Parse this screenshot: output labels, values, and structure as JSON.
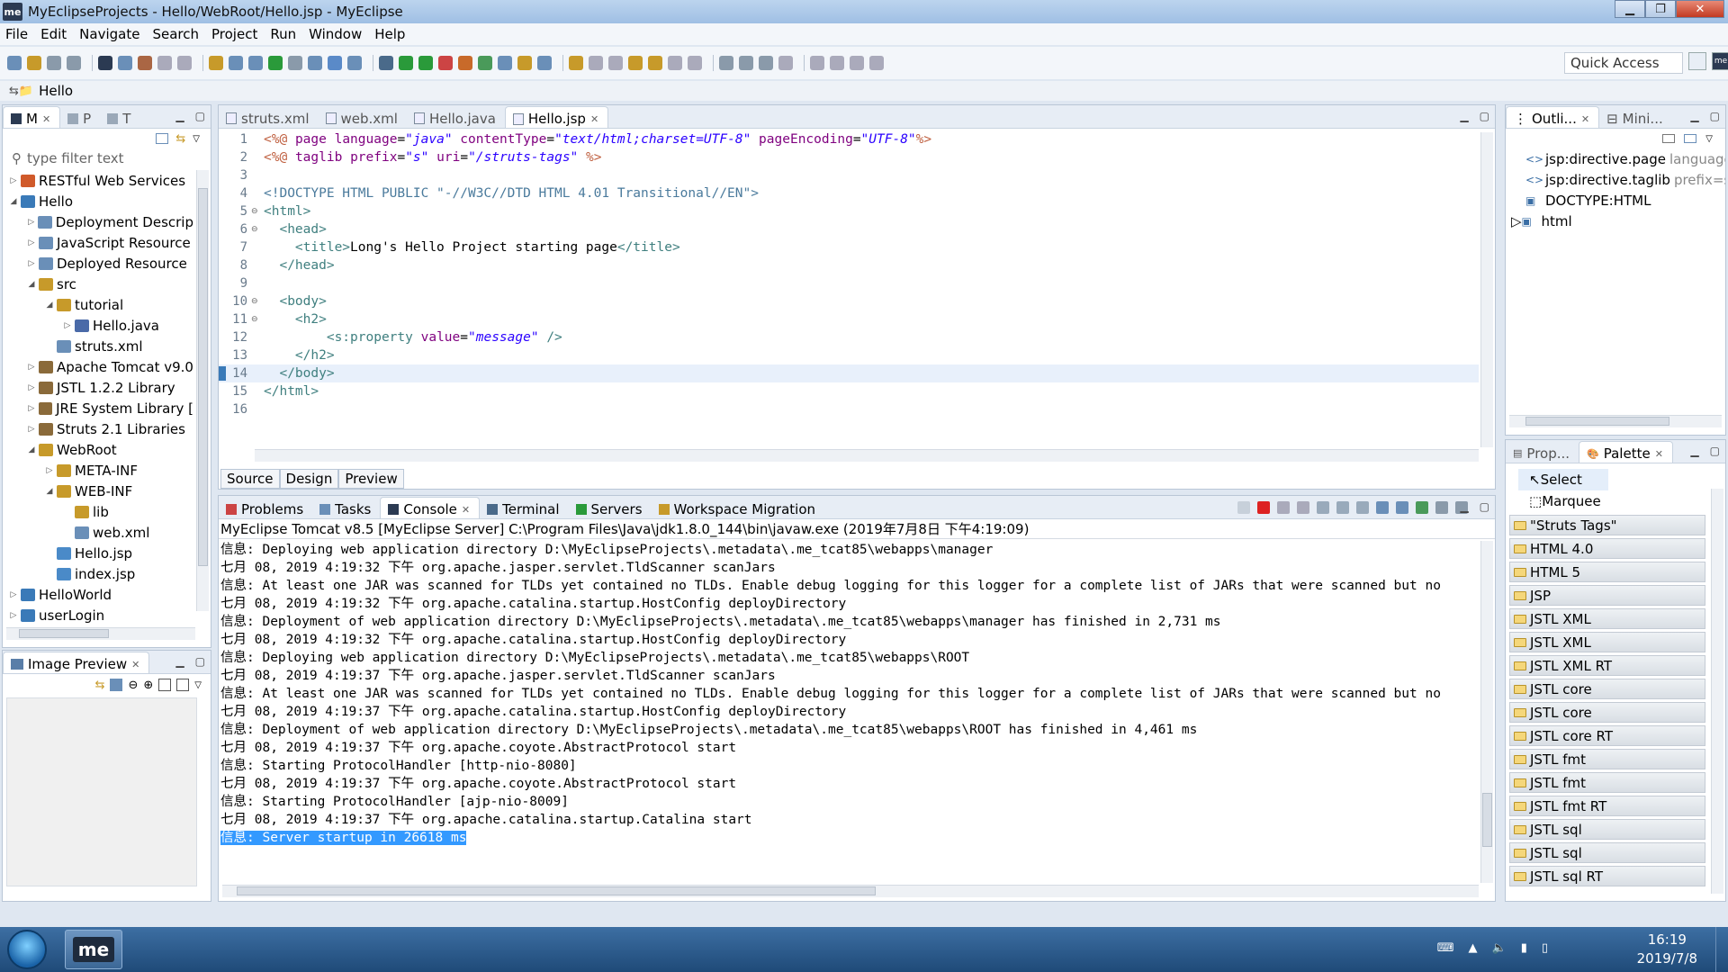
{
  "window": {
    "title": "MyEclipseProjects - Hello/WebRoot/Hello.jsp - MyEclipse",
    "logo": "me"
  },
  "menu": [
    "File",
    "Edit",
    "Navigate",
    "Search",
    "Project",
    "Run",
    "Window",
    "Help"
  ],
  "quick_access": "Quick Access",
  "breadcrumb": "Hello",
  "explorer": {
    "tabs": [
      "M",
      "P",
      "T"
    ],
    "filter_placeholder": "type filter text",
    "items": [
      {
        "label": "RESTful Web Services",
        "level": 0,
        "arrow": "▷"
      },
      {
        "label": "Hello",
        "level": 0,
        "arrow": "◢"
      },
      {
        "label": "Deployment Descrip",
        "level": 1,
        "arrow": "▷"
      },
      {
        "label": "JavaScript Resource",
        "level": 1,
        "arrow": "▷"
      },
      {
        "label": "Deployed Resource",
        "level": 1,
        "arrow": "▷"
      },
      {
        "label": "src",
        "level": 1,
        "arrow": "◢"
      },
      {
        "label": "tutorial",
        "level": 2,
        "arrow": "◢"
      },
      {
        "label": "Hello.java",
        "level": 3,
        "arrow": "▷"
      },
      {
        "label": "struts.xml",
        "level": 2,
        "arrow": ""
      },
      {
        "label": "Apache Tomcat v9.0",
        "level": 1,
        "arrow": "▷"
      },
      {
        "label": "JSTL 1.2.2 Library",
        "level": 1,
        "arrow": "▷"
      },
      {
        "label": "JRE System Library [",
        "level": 1,
        "arrow": "▷"
      },
      {
        "label": "Struts 2.1 Libraries",
        "level": 1,
        "arrow": "▷"
      },
      {
        "label": "WebRoot",
        "level": 1,
        "arrow": "◢"
      },
      {
        "label": "META-INF",
        "level": 2,
        "arrow": "▷"
      },
      {
        "label": "WEB-INF",
        "level": 2,
        "arrow": "◢"
      },
      {
        "label": "lib",
        "level": 3,
        "arrow": ""
      },
      {
        "label": "web.xml",
        "level": 3,
        "arrow": ""
      },
      {
        "label": "Hello.jsp",
        "level": 2,
        "arrow": ""
      },
      {
        "label": "index.jsp",
        "level": 2,
        "arrow": ""
      },
      {
        "label": "HelloWorld",
        "level": 0,
        "arrow": "▷"
      },
      {
        "label": "userLogin",
        "level": 0,
        "arrow": "▷"
      }
    ]
  },
  "image_preview": {
    "title": "Image Preview"
  },
  "editor": {
    "tabs": [
      {
        "label": "struts.xml",
        "active": false
      },
      {
        "label": "web.xml",
        "active": false
      },
      {
        "label": "Hello.java",
        "active": false
      },
      {
        "label": "Hello.jsp",
        "active": true
      }
    ],
    "lines": [
      {
        "n": "1",
        "fold": "",
        "html": "<span class='dir'>&lt;%@</span> <span class='attr'>page</span> <span class='attr'>language</span>=<span class='val'>\"java\"</span> <span class='attr'>contentType</span>=<span class='val'>\"text/html;charset=UTF-8\"</span> <span class='attr'>pageEncoding</span>=<span class='val'>\"UTF-8\"</span><span class='dir'>%&gt;</span>"
      },
      {
        "n": "2",
        "fold": "",
        "html": "<span class='dir'>&lt;%@</span> <span class='attr'>taglib</span> <span class='attr'>prefix</span>=<span class='val'>\"s\"</span> <span class='attr'>uri</span>=<span class='val'>\"/struts-tags\"</span> <span class='dir'>%&gt;</span>"
      },
      {
        "n": "3",
        "fold": "",
        "html": ""
      },
      {
        "n": "4",
        "fold": "",
        "html": "<span class='doct'>&lt;!DOCTYPE HTML PUBLIC \"-//W3C//DTD HTML 4.01 Transitional//EN\"&gt;</span>"
      },
      {
        "n": "5",
        "fold": "⊖",
        "html": "<span class='tag'>&lt;html&gt;</span>"
      },
      {
        "n": "6",
        "fold": "⊖",
        "html": "  <span class='tag'>&lt;head&gt;</span>"
      },
      {
        "n": "7",
        "fold": "",
        "html": "    <span class='tag'>&lt;title&gt;</span>Long's Hello Project starting page<span class='tag'>&lt;/title&gt;</span>"
      },
      {
        "n": "8",
        "fold": "",
        "html": "  <span class='tag'>&lt;/head&gt;</span>"
      },
      {
        "n": "9",
        "fold": "",
        "html": ""
      },
      {
        "n": "10",
        "fold": "⊖",
        "html": "  <span class='tag'>&lt;body&gt;</span>"
      },
      {
        "n": "11",
        "fold": "⊖",
        "html": "    <span class='tag'>&lt;h2&gt;</span>"
      },
      {
        "n": "12",
        "fold": "",
        "html": "        <span class='tag'>&lt;s:property</span> <span class='attr'>value</span>=<span class='val'>\"message\"</span> <span class='tag'>/&gt;</span>"
      },
      {
        "n": "13",
        "fold": "",
        "html": "    <span class='tag'>&lt;/h2&gt;</span>"
      },
      {
        "n": "14",
        "fold": "",
        "html": "  <span class='tag'>&lt;/body&gt;</span>",
        "current": true
      },
      {
        "n": "15",
        "fold": "",
        "html": "<span class='tag'>&lt;/html&gt;</span>"
      },
      {
        "n": "16",
        "fold": "",
        "html": ""
      }
    ],
    "mode_tabs": [
      "Source",
      "Design",
      "Preview"
    ]
  },
  "console": {
    "tabs": [
      {
        "label": "Problems",
        "active": false
      },
      {
        "label": "Tasks",
        "active": false
      },
      {
        "label": "Console",
        "active": true
      },
      {
        "label": "Terminal",
        "active": false
      },
      {
        "label": "Servers",
        "active": false
      },
      {
        "label": "Workspace Migration",
        "active": false
      }
    ],
    "process": "MyEclipse Tomcat v8.5 [MyEclipse Server] C:\\Program Files\\Java\\jdk1.8.0_144\\bin\\javaw.exe (2019年7月8日 下午4:19:09)",
    "lines": [
      "信息: Deploying web application directory D:\\MyEclipseProjects\\.metadata\\.me_tcat85\\webapps\\manager",
      "七月 08, 2019 4:19:32 下午 org.apache.jasper.servlet.TldScanner scanJars",
      "信息: At least one JAR was scanned for TLDs yet contained no TLDs. Enable debug logging for this logger for a complete list of JARs that were scanned but no",
      "七月 08, 2019 4:19:32 下午 org.apache.catalina.startup.HostConfig deployDirectory",
      "信息: Deployment of web application directory D:\\MyEclipseProjects\\.metadata\\.me_tcat85\\webapps\\manager has finished in 2,731 ms",
      "七月 08, 2019 4:19:32 下午 org.apache.catalina.startup.HostConfig deployDirectory",
      "信息: Deploying web application directory D:\\MyEclipseProjects\\.metadata\\.me_tcat85\\webapps\\ROOT",
      "七月 08, 2019 4:19:37 下午 org.apache.jasper.servlet.TldScanner scanJars",
      "信息: At least one JAR was scanned for TLDs yet contained no TLDs. Enable debug logging for this logger for a complete list of JARs that were scanned but no",
      "七月 08, 2019 4:19:37 下午 org.apache.catalina.startup.HostConfig deployDirectory",
      "信息: Deployment of web application directory D:\\MyEclipseProjects\\.metadata\\.me_tcat85\\webapps\\ROOT has finished in 4,461 ms",
      "七月 08, 2019 4:19:37 下午 org.apache.coyote.AbstractProtocol start",
      "信息: Starting ProtocolHandler [http-nio-8080]",
      "七月 08, 2019 4:19:37 下午 org.apache.coyote.AbstractProtocol start",
      "信息: Starting ProtocolHandler [ajp-nio-8009]",
      "七月 08, 2019 4:19:37 下午 org.apache.catalina.startup.Catalina start"
    ],
    "highlighted_line": "信息: Server startup in 26618 ms"
  },
  "outline": {
    "tabs": [
      "Outli...",
      "Mini..."
    ],
    "items": [
      {
        "label": "jsp:directive.page",
        "hint": "language",
        "icon": "<>"
      },
      {
        "label": "jsp:directive.taglib",
        "hint": "prefix=s",
        "icon": "<>"
      },
      {
        "label": "DOCTYPE:HTML",
        "hint": "",
        "icon": "▣"
      },
      {
        "label": "html",
        "hint": "",
        "icon": "▣"
      }
    ]
  },
  "palette": {
    "tabs": [
      "Prop...",
      "Palette"
    ],
    "tools": [
      "Select",
      "Marquee"
    ],
    "drawers": [
      "\"Struts Tags\"",
      "HTML 4.0",
      "HTML 5",
      "JSP",
      "JSTL XML",
      "JSTL XML",
      "JSTL XML RT",
      "JSTL core",
      "JSTL core",
      "JSTL core RT",
      "JSTL fmt",
      "JSTL fmt",
      "JSTL fmt RT",
      "JSTL sql",
      "JSTL sql",
      "JSTL sql RT"
    ]
  },
  "taskbar": {
    "app": "me",
    "time": "16:19",
    "date": "2019/7/8"
  },
  "colors": {
    "accent": "#3399ff",
    "tag": "#3f7f7f",
    "attr": "#7f007f",
    "value": "#2a00ff"
  }
}
